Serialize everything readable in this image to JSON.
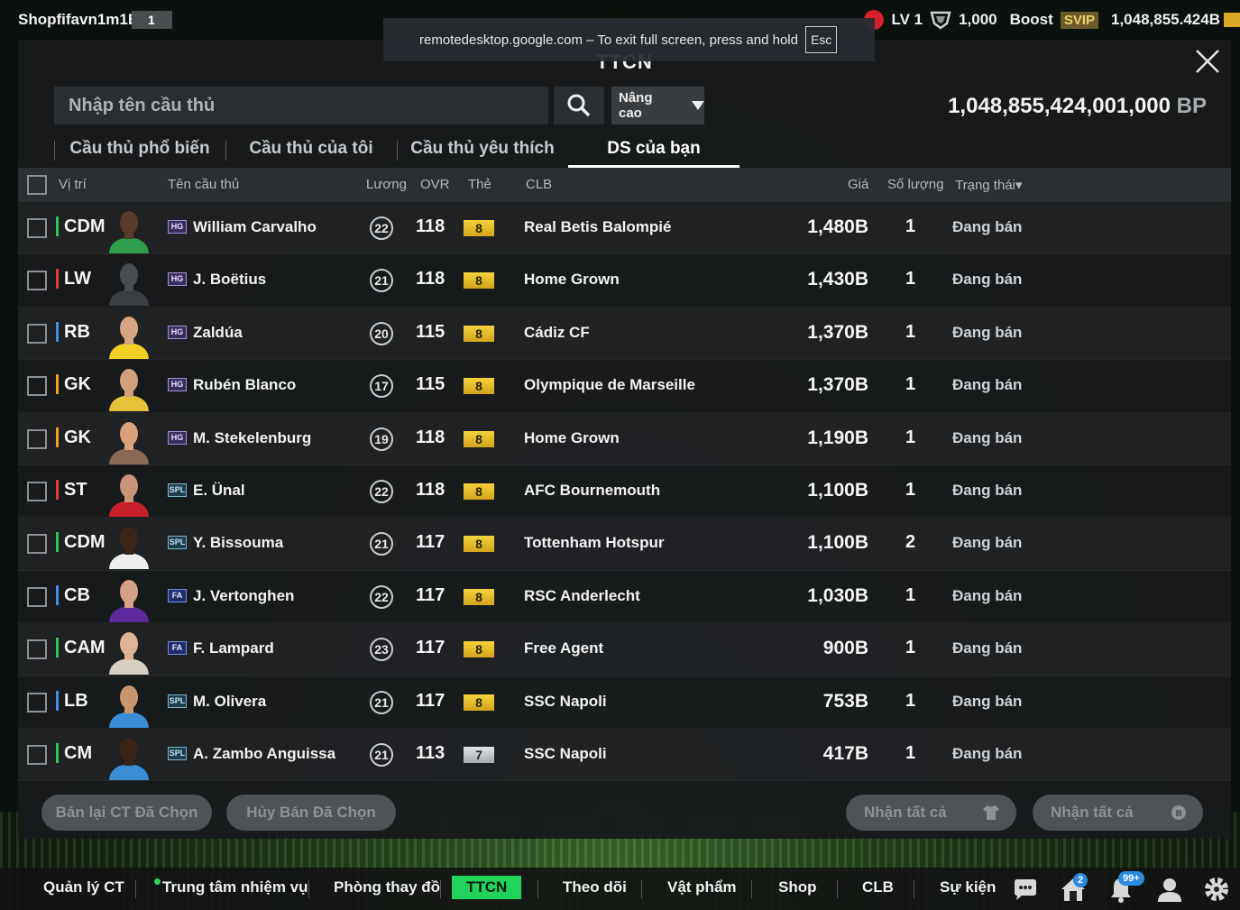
{
  "topbar": {
    "username": "Shopfifavn1m1B",
    "user_level": "1",
    "lv_label": "LV 1",
    "shield_points": "1,000",
    "boost_label": "Boost",
    "svip_label": "SVIP",
    "bp_balance": "1,048,855.424B"
  },
  "remote_banner": {
    "text": "remotedesktop.google.com – To exit full screen, press and hold",
    "key": "Esc"
  },
  "panel": {
    "title": "TTCN",
    "search_placeholder": "Nhập tên cầu thủ",
    "advanced_label": "Nâng cao",
    "bp_total": "1,048,855,424,001,000",
    "bp_unit": "BP"
  },
  "tabs": [
    {
      "label": "Cầu thủ phổ biến",
      "active": false
    },
    {
      "label": "Cầu thủ của tôi",
      "active": false
    },
    {
      "label": "Cầu thủ yêu thích",
      "active": false
    },
    {
      "label": "DS của bạn",
      "active": true
    }
  ],
  "columns": {
    "position": "Vị trí",
    "name": "Tên cầu thủ",
    "salary": "Lương",
    "ovr": "OVR",
    "card": "Thẻ",
    "club": "CLB",
    "price": "Giá",
    "quantity": "Số lượng",
    "status": "Trạng thái▾"
  },
  "players": [
    {
      "pos": "CDM",
      "pos_group": "mid",
      "season": "HG",
      "name": "William Carvalho",
      "salary": "22",
      "ovr": "118",
      "grade": "8",
      "club": "Real Betis Balompié",
      "price": "1,480B",
      "qty": "1",
      "status": "Đang bán",
      "shirt": "#2f9e4c",
      "skin": "#5a3b2a"
    },
    {
      "pos": "LW",
      "pos_group": "att",
      "season": "HG",
      "name": "J. Boëtius",
      "salary": "21",
      "ovr": "118",
      "grade": "8",
      "club": "Home Grown",
      "price": "1,430B",
      "qty": "1",
      "status": "Đang bán",
      "shirt": "#3b3f43",
      "skin": "#4a4e52"
    },
    {
      "pos": "RB",
      "pos_group": "def",
      "season": "HG",
      "name": "Zaldúa",
      "salary": "20",
      "ovr": "115",
      "grade": "8",
      "club": "Cádiz CF",
      "price": "1,370B",
      "qty": "1",
      "status": "Đang bán",
      "shirt": "#f2d023",
      "skin": "#d9a684"
    },
    {
      "pos": "GK",
      "pos_group": "gk",
      "season": "HG",
      "name": "Rubén Blanco",
      "salary": "17",
      "ovr": "115",
      "grade": "8",
      "club": "Olympique de Marseille",
      "price": "1,370B",
      "qty": "1",
      "status": "Đang bán",
      "shirt": "#e5c23a",
      "skin": "#d4a07c"
    },
    {
      "pos": "GK",
      "pos_group": "gk",
      "season": "HG",
      "name": "M. Stekelenburg",
      "salary": "19",
      "ovr": "118",
      "grade": "8",
      "club": "Home Grown",
      "price": "1,190B",
      "qty": "1",
      "status": "Đang bán",
      "shirt": "#8a6a55",
      "skin": "#d9a07a"
    },
    {
      "pos": "ST",
      "pos_group": "att",
      "season": "SPL",
      "name": "E. Ünal",
      "salary": "22",
      "ovr": "118",
      "grade": "8",
      "club": "AFC Bournemouth",
      "price": "1,100B",
      "qty": "1",
      "status": "Đang bán",
      "shirt": "#c8202a",
      "skin": "#c99477"
    },
    {
      "pos": "CDM",
      "pos_group": "mid",
      "season": "SPL",
      "name": "Y. Bissouma",
      "salary": "21",
      "ovr": "117",
      "grade": "8",
      "club": "Tottenham Hotspur",
      "price": "1,100B",
      "qty": "2",
      "status": "Đang bán",
      "shirt": "#eeeeee",
      "skin": "#3b2518"
    },
    {
      "pos": "CB",
      "pos_group": "def",
      "season": "FA",
      "name": "J. Vertonghen",
      "salary": "22",
      "ovr": "117",
      "grade": "8",
      "club": "RSC Anderlecht",
      "price": "1,030B",
      "qty": "1",
      "status": "Đang bán",
      "shirt": "#5b2a9c",
      "skin": "#d6a184"
    },
    {
      "pos": "CAM",
      "pos_group": "mid",
      "season": "FA",
      "name": "F. Lampard",
      "salary": "23",
      "ovr": "117",
      "grade": "8",
      "club": "Free Agent",
      "price": "900B",
      "qty": "1",
      "status": "Đang bán",
      "shirt": "#d8d0c4",
      "skin": "#e0b394"
    },
    {
      "pos": "LB",
      "pos_group": "def",
      "season": "SPL",
      "name": "M. Olivera",
      "salary": "21",
      "ovr": "117",
      "grade": "8",
      "club": "SSC Napoli",
      "price": "753B",
      "qty": "1",
      "status": "Đang bán",
      "shirt": "#3a8ed6",
      "skin": "#c9956f"
    },
    {
      "pos": "CM",
      "pos_group": "mid",
      "season": "SPL",
      "name": "A. Zambo Anguissa",
      "salary": "21",
      "ovr": "113",
      "grade": "7",
      "club": "SSC Napoli",
      "price": "417B",
      "qty": "1",
      "status": "Đang bán",
      "shirt": "#3a8ed6",
      "skin": "#3a2418"
    }
  ],
  "actions": {
    "resell_selected": "Bán lại CT Đã Chọn",
    "cancel_selected": "Hủy Bán Đã Chọn",
    "receive_all_players": "Nhận tất cả",
    "receive_all_bp": "Nhận tất cả"
  },
  "bottom_nav": {
    "items": [
      "Quản lý CT",
      "Trung tâm nhiệm vụ",
      "Phòng thay đồ",
      "TTCN",
      "Theo dõi",
      "Vật phẩm",
      "Shop",
      "CLB",
      "Sự kiện"
    ],
    "active": "TTCN",
    "mail_badge": "2",
    "notification_badge": "99+"
  },
  "colors": {
    "accent_green": "#1fd35c",
    "grade_gold": "#f4d23d",
    "panel_bg": "#181a1c"
  }
}
